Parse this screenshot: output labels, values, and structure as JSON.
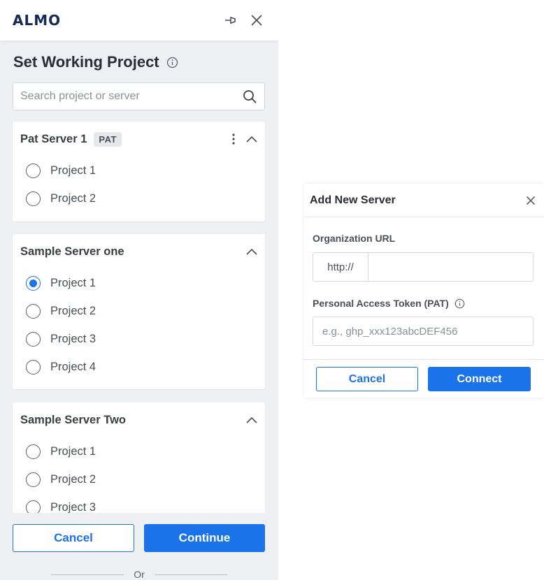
{
  "brand": {
    "logo_text": "ALMO"
  },
  "panel": {
    "title": "Set Working Project",
    "search_placeholder": "Search project or server",
    "servers": [
      {
        "name": "Pat Server 1",
        "badge": "PAT",
        "projects": [
          "Project 1",
          "Project 2"
        ],
        "selected": null
      },
      {
        "name": "Sample Server one",
        "projects": [
          "Project 1",
          "Project 2",
          "Project 3",
          "Project 4"
        ],
        "selected": "Project 1"
      },
      {
        "name": "Sample Server Two",
        "projects": [
          "Project 1",
          "Project 2",
          "Project 3"
        ],
        "selected": null
      }
    ],
    "cancel_label": "Cancel",
    "continue_label": "Continue",
    "or_text": "Or"
  },
  "dialog": {
    "title": "Add New Server",
    "org_url_label": "Organization URL",
    "url_prefix": "http://",
    "pat_label": "Personal Access Token (PAT)",
    "pat_placeholder": "e.g., ghp_xxx123abcDEF456",
    "cancel_label": "Cancel",
    "connect_label": "Connect"
  },
  "colors": {
    "accent": "#1a73e8",
    "brand": "#152a54",
    "panel_bg": "#eef0f3"
  },
  "icons": [
    "pin-icon",
    "close-icon",
    "info-icon",
    "search-icon",
    "more-vertical-icon",
    "chevron-up-icon"
  ]
}
